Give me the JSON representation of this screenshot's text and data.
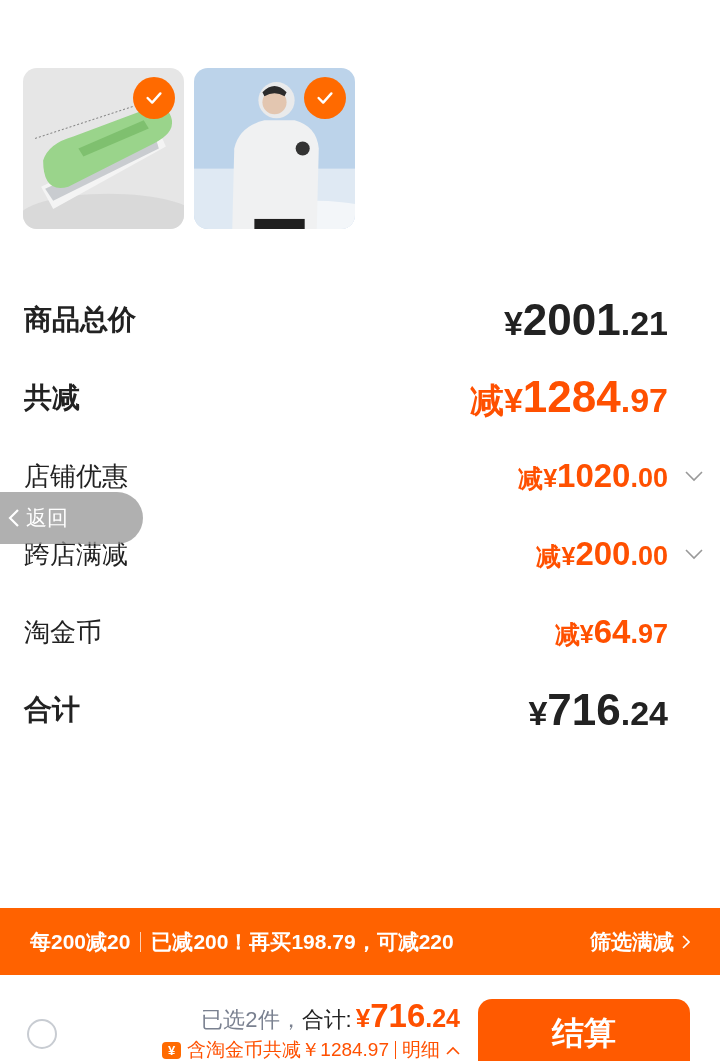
{
  "products": [
    {
      "kind": "picture",
      "selected": true
    },
    {
      "kind": "picture",
      "selected": true
    }
  ],
  "summary": [
    {
      "kind": "total",
      "label": "商品总价",
      "amount": "¥2001.21"
    },
    {
      "kind": "discount-total",
      "label": "共减",
      "amount": "减¥1284.97"
    },
    {
      "kind": "discount",
      "label": "店铺优惠",
      "amount": "减¥1020.00",
      "expanded": false
    },
    {
      "kind": "discount",
      "label": "跨店满减",
      "amount": "减¥200.00",
      "expanded": false
    },
    {
      "kind": "discount",
      "label": "淘金币",
      "amount": "减¥64.97"
    },
    {
      "kind": "total",
      "label": "合计",
      "amount": "¥716.24"
    }
  ],
  "back_button": {
    "label": "返回"
  },
  "promo_banner": {
    "rule": "每200减20",
    "message": "已减200！再买198.79，可减220",
    "action": "筛选满减"
  },
  "checkout_bar": {
    "select_all": {
      "checked": false
    },
    "count": "已选2件，",
    "total_label": "合计:",
    "total": "¥716.24",
    "coin_badge": "¥",
    "discount_note": "含淘金币共减￥1284.97",
    "details_link": "明细",
    "details_expanded": false,
    "checkout": "结算"
  }
}
